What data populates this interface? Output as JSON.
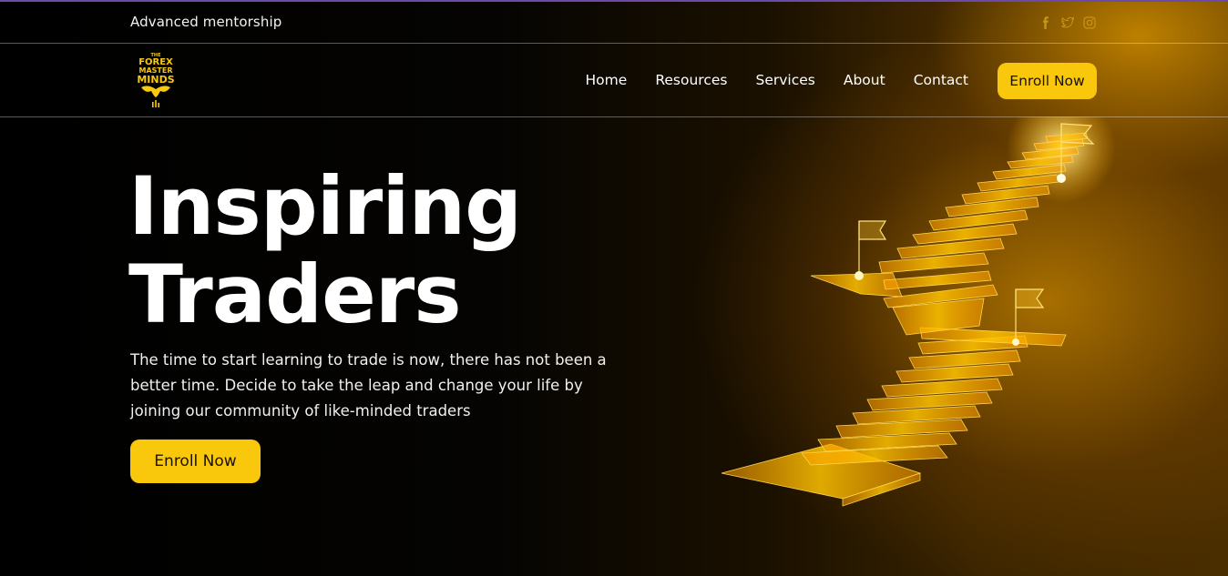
{
  "topbar": {
    "text": "Advanced mentorship",
    "social_icons": [
      "facebook-icon",
      "twitter-icon",
      "instagram-icon"
    ],
    "icon_color": "#c8951a"
  },
  "logo": {
    "lines": [
      "THE",
      "FOREX",
      "MASTER",
      "MINDS"
    ],
    "color": "#f9c70c"
  },
  "nav": {
    "items": [
      {
        "label": "Home"
      },
      {
        "label": "Resources"
      },
      {
        "label": "Services"
      },
      {
        "label": "About"
      },
      {
        "label": "Contact"
      }
    ],
    "cta_label": "Enroll Now"
  },
  "hero": {
    "title_line1": "Inspiring",
    "title_line2": "Traders",
    "description": "The time to start learning to trade is now, there has not been a better time. Decide to take the leap and change your life by joining our community of like-minded traders",
    "cta_label": "Enroll Now"
  },
  "colors": {
    "accent": "#f9c70c",
    "background": "#000000",
    "glow": "#ffb000"
  }
}
